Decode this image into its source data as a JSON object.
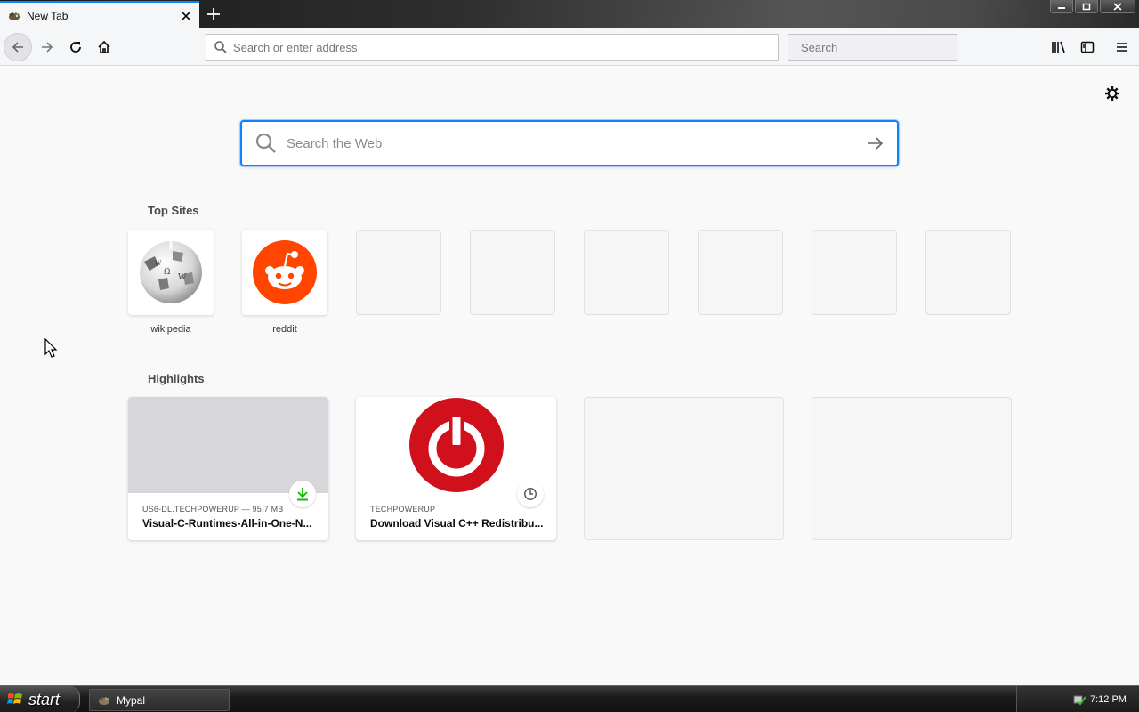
{
  "window": {
    "tab_title": "New Tab",
    "accent_color": "#0a84ff"
  },
  "navbar": {
    "url_placeholder": "Search or enter address",
    "search_placeholder": "Search"
  },
  "newtab": {
    "web_search_placeholder": "Search the Web",
    "top_sites_title": "Top Sites",
    "top_sites": [
      {
        "label": "wikipedia",
        "icon": "wikipedia-globe-icon"
      },
      {
        "label": "reddit",
        "icon": "reddit-icon"
      }
    ],
    "highlights_title": "Highlights",
    "highlights": [
      {
        "meta": "US6-DL.TECHPOWERUP — 95.7 MB",
        "title": "Visual-C-Runtimes-All-in-One-N...",
        "badge": "download-icon"
      },
      {
        "meta": "TECHPOWERUP",
        "title": "Download Visual C++ Redistribu...",
        "badge": "clock-icon"
      }
    ]
  },
  "taskbar": {
    "start_label": "start",
    "task_label": "Mypal",
    "clock": "7:12 PM"
  }
}
